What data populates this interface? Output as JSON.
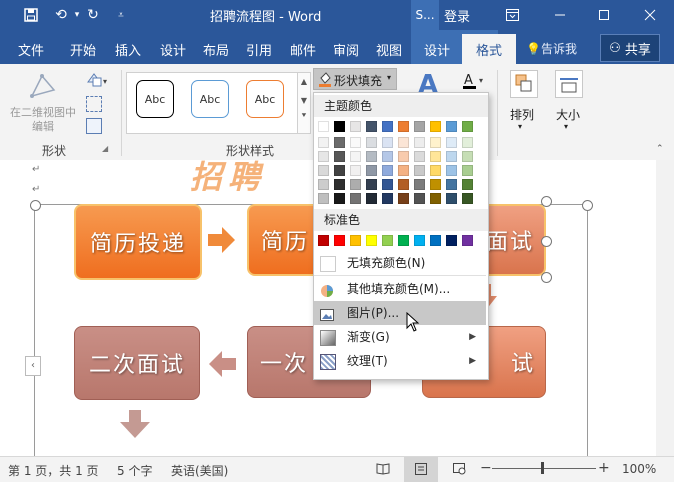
{
  "title_bar": {
    "doc_title": "招聘流程图 - Word",
    "context_tab_short": "S...",
    "login": "登录",
    "icons": [
      "save-icon",
      "undo-icon",
      "redo-icon",
      "customize-qat-icon",
      "ribbon-display-icon",
      "minimize-icon",
      "maximize-icon",
      "close-icon"
    ]
  },
  "tabs": {
    "file": "文件",
    "home": "开始",
    "insert": "插入",
    "design": "设计",
    "layout": "布局",
    "references": "引用",
    "mailings": "邮件",
    "review": "审阅",
    "view": "视图",
    "ctx_design": "设计",
    "format": "格式",
    "tell_me": "告诉我",
    "share": "共享"
  },
  "ribbon": {
    "edit_2d_line1": "在二维视图中",
    "edit_2d_line2": "编辑",
    "group_shape": "形状",
    "style_sample": "Abc",
    "group_shape_styles": "形状样式",
    "shape_fill": "形状填充",
    "arrange": "排列",
    "size": "大小"
  },
  "document": {
    "title_fragment": "招聘",
    "boxes": {
      "resume": "简历投递",
      "resume2": "简历",
      "interview": "面试",
      "second": "二次面试",
      "first": "一次",
      "interview2": "试"
    }
  },
  "dropdown": {
    "theme_colors": "主题颜色",
    "standard_colors": "标准色",
    "no_fill": "无填充颜色(N)",
    "more_colors": "其他填充颜色(M)...",
    "picture": "图片(P)...",
    "gradient": "渐变(G)",
    "texture": "纹理(T)",
    "theme_top_row": [
      "#ffffff",
      "#000000",
      "#e7e6e6",
      "#44546a",
      "#4472c4",
      "#ed7d31",
      "#a5a5a5",
      "#ffc000",
      "#5b9bd5",
      "#70ad47"
    ],
    "standard": [
      "#c00000",
      "#ff0000",
      "#ffc000",
      "#ffff00",
      "#92d050",
      "#00b050",
      "#00b0f0",
      "#0070c0",
      "#002060",
      "#7030a0"
    ]
  },
  "status": {
    "page": "第 1 页，共 1 页",
    "words": "5 个字",
    "language": "英语(美国)",
    "zoom": "100%"
  }
}
